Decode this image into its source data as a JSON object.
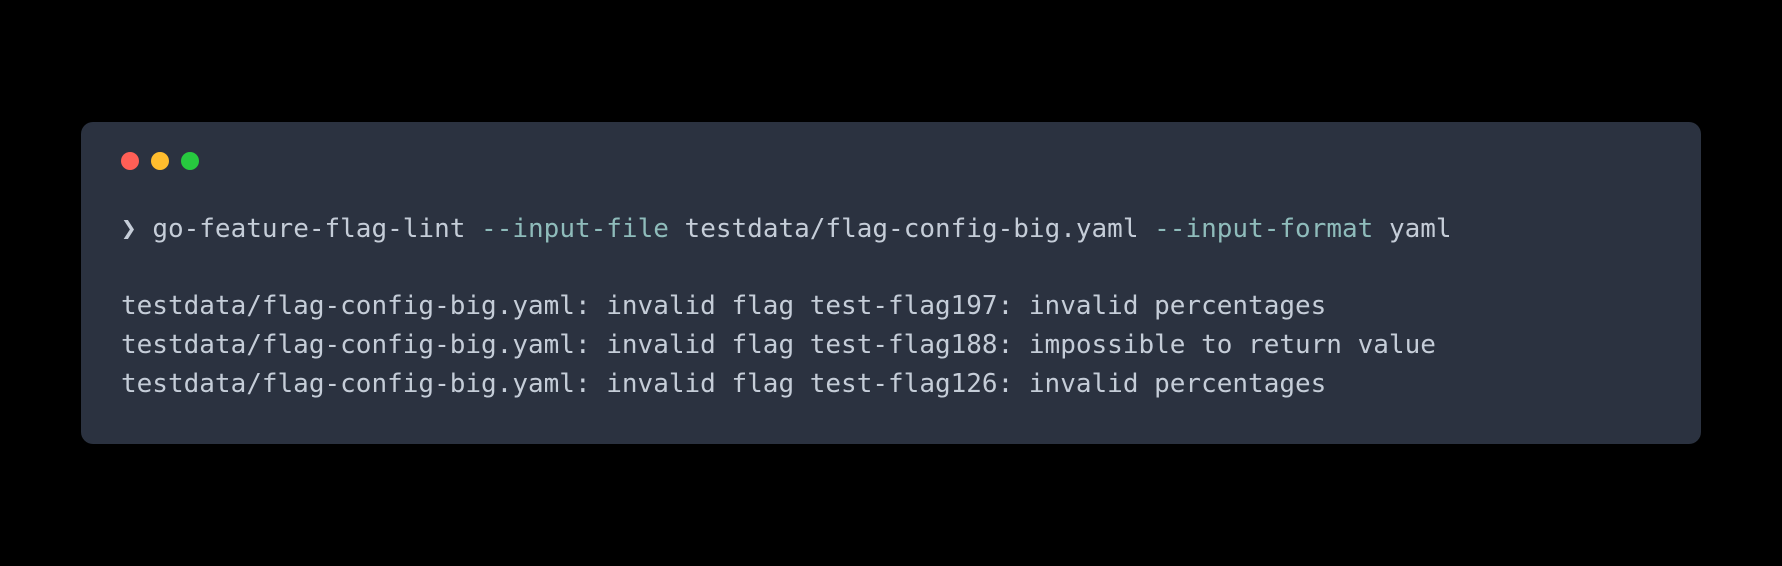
{
  "command": {
    "prompt": "❯",
    "executable": "go-feature-flag-lint",
    "flag1": "--input-file",
    "arg1": "testdata/flag-config-big.yaml",
    "flag2": "--input-format",
    "arg2": "yaml"
  },
  "output": {
    "lines": [
      "testdata/flag-config-big.yaml: invalid flag test-flag197: invalid percentages",
      "testdata/flag-config-big.yaml: invalid flag test-flag188: impossible to return value",
      "testdata/flag-config-big.yaml: invalid flag test-flag126: invalid percentages"
    ]
  }
}
